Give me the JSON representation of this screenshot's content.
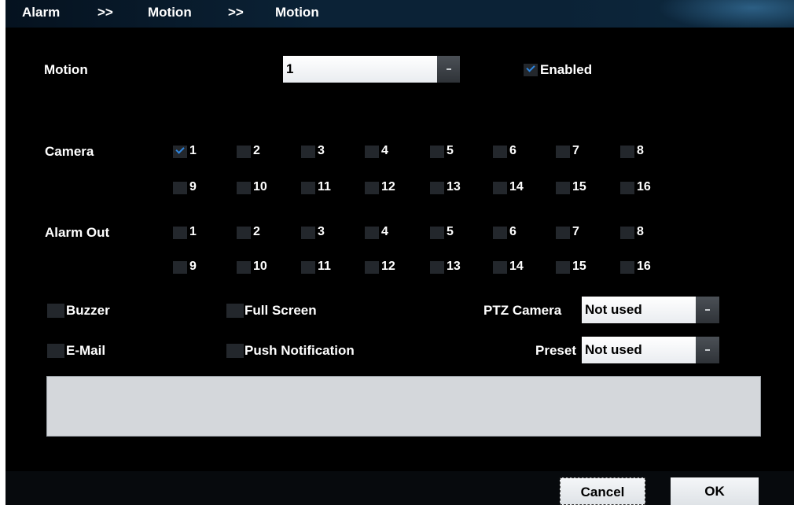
{
  "breadcrumb": [
    "Alarm",
    ">>",
    "Motion",
    ">>",
    "Motion"
  ],
  "motion": {
    "label": "Motion",
    "value": "1",
    "enabled_label": "Enabled",
    "enabled": true
  },
  "camera": {
    "label": "Camera",
    "items": [
      "1",
      "2",
      "3",
      "4",
      "5",
      "6",
      "7",
      "8",
      "9",
      "10",
      "11",
      "12",
      "13",
      "14",
      "15",
      "16"
    ],
    "checked": [
      1
    ]
  },
  "alarm_out": {
    "label": "Alarm Out",
    "items": [
      "1",
      "2",
      "3",
      "4",
      "5",
      "6",
      "7",
      "8",
      "9",
      "10",
      "11",
      "12",
      "13",
      "14",
      "15",
      "16"
    ],
    "checked": []
  },
  "options": {
    "buzzer": "Buzzer",
    "full_screen": "Full Screen",
    "email": "E-Mail",
    "push": "Push Notification"
  },
  "ptz": {
    "label": "PTZ Camera",
    "value": "Not used"
  },
  "preset": {
    "label": "Preset",
    "value": "Not used"
  },
  "buttons": {
    "cancel": "Cancel",
    "ok": "OK"
  },
  "colors": {
    "background": "#000000",
    "check_accent": "#2e86e0",
    "header": "#0b2236"
  }
}
